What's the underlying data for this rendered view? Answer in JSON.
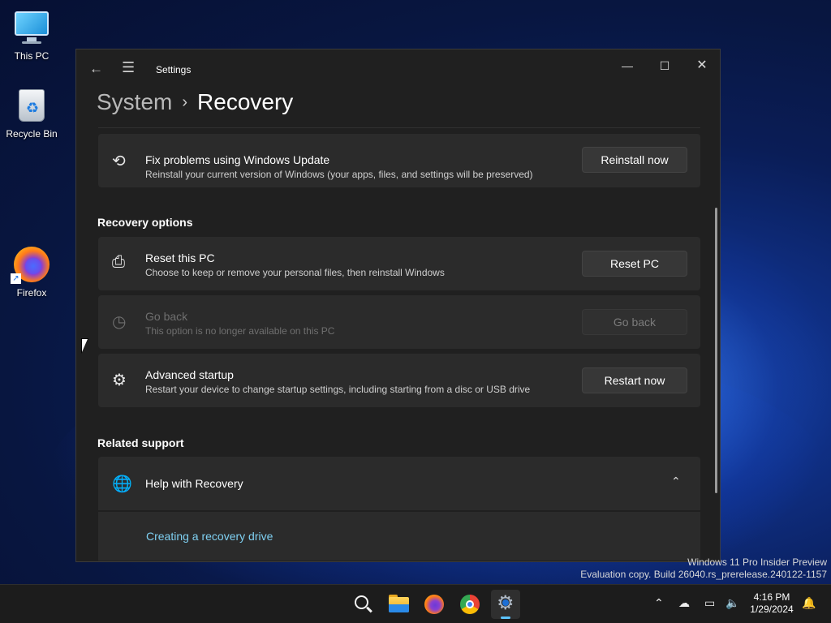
{
  "desktop": {
    "icons": [
      {
        "label": "This PC"
      },
      {
        "label": "Recycle Bin"
      },
      {
        "label": "Firefox"
      }
    ]
  },
  "window": {
    "title": "Settings",
    "controls": {
      "minimize": "—",
      "maximize": "☐",
      "close": "✕"
    },
    "back_glyph": "←",
    "menu_glyph": "☰"
  },
  "breadcrumb": {
    "parent": "System",
    "separator": "›",
    "current": "Recovery"
  },
  "cards": {
    "fix_problems": {
      "icon": "refresh-icon",
      "glyph": "⟲",
      "title": "Fix problems using Windows Update",
      "description": "Reinstall your current version of Windows (your apps, files, and settings will be preserved)",
      "button": "Reinstall now"
    },
    "reset_pc": {
      "icon": "reset-pc-icon",
      "glyph": "⎙",
      "title": "Reset this PC",
      "description": "Choose to keep or remove your personal files, then reinstall Windows",
      "button": "Reset PC"
    },
    "go_back": {
      "icon": "history-icon",
      "glyph": "◷",
      "title": "Go back",
      "description": "This option is no longer available on this PC",
      "button": "Go back",
      "disabled": true
    },
    "advanced_startup": {
      "icon": "advanced-startup-icon",
      "glyph": "⚙",
      "title": "Advanced startup",
      "description": "Restart your device to change startup settings, including starting from a disc or USB drive",
      "button": "Restart now"
    }
  },
  "sections": {
    "recovery_options": "Recovery options",
    "related_support": "Related support"
  },
  "help": {
    "icon": "globe-icon",
    "glyph": "🌐",
    "title": "Help with Recovery",
    "chevron": "⌃",
    "link": "Creating a recovery drive"
  },
  "watermark": {
    "line1": "Windows 11 Pro Insider Preview",
    "line2": "Evaluation copy. Build 26040.rs_prerelease.240122-1157"
  },
  "taskbar": {
    "time": "4:16 PM",
    "date": "1/29/2024",
    "tray": {
      "chevron": "⌃",
      "cloud": "☁",
      "network": "▭",
      "volume": "🔈",
      "bell": "🔔"
    }
  },
  "colors": {
    "link": "#7fd0f2",
    "window_bg": "#202020",
    "card_bg": "#2b2b2b",
    "accent": "#5cc3ff"
  }
}
